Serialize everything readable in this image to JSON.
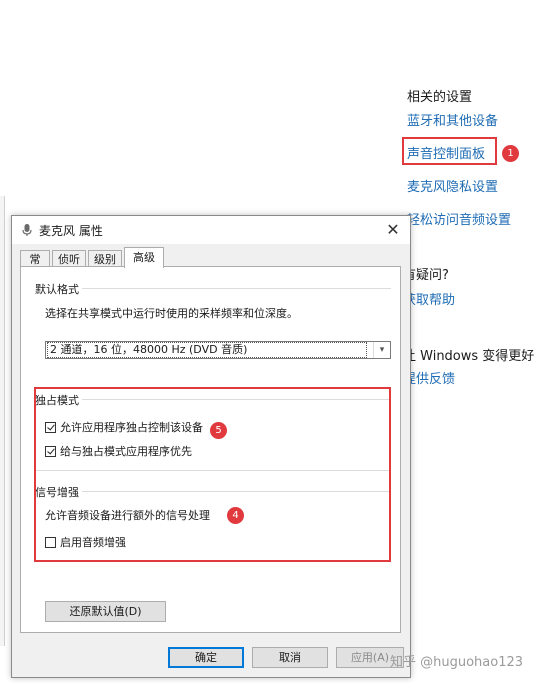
{
  "settings": {
    "related_title": "相关的设置",
    "links": {
      "bluetooth": "蓝牙和其他设备",
      "sound_control_panel": "声音控制面板",
      "mic_privacy": "麦克风隐私设置",
      "ease_audio": "轻松访问音频设置"
    },
    "help_question": "有疑问?",
    "get_help": "获取帮助",
    "improve": "让 Windows 变得更好",
    "feedback": "提供反馈"
  },
  "badges": {
    "b1": "1",
    "b4": "4",
    "b5": "5"
  },
  "dialog": {
    "title": "麦克风 属性",
    "close": "✕",
    "tabs": [
      "常规",
      "侦听",
      "级别",
      "高级"
    ],
    "default_format": {
      "label": "默认格式",
      "description": "选择在共享模式中运行时使用的采样频率和位深度。",
      "selected": "2 通道，16 位，48000 Hz (DVD 音质)"
    },
    "exclusive": {
      "label": "独占模式",
      "allow_exclusive": "允许应用程序独占控制该设备",
      "give_priority": "给与独占模式应用程序优先"
    },
    "enhancement": {
      "label": "信号增强",
      "description": "允许音频设备进行额外的信号处理",
      "enable": "启用音频增强"
    },
    "restore_defaults": "还原默认值(D)",
    "ok": "确定",
    "cancel": "取消",
    "apply": "应用(A)"
  },
  "watermark": "知乎 @huguohao123",
  "colors": {
    "accent_link": "#1f6cb4",
    "highlight_red": "#e0393e",
    "dialog_bg": "#f0f0f0"
  }
}
